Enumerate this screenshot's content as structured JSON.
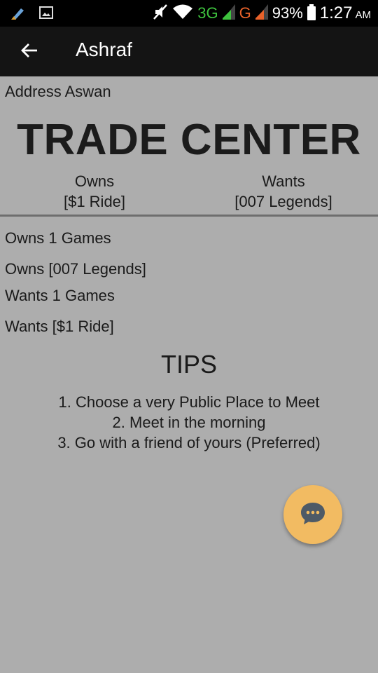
{
  "status_bar": {
    "network_1": "3G",
    "network_2": "G",
    "battery": "93%",
    "time": "1:27",
    "ampm": "AM",
    "colors": {
      "network_1": "#3ec23e",
      "network_2": "#e8622a"
    }
  },
  "app_bar": {
    "title": "Ashraf",
    "back_icon": "arrow-left-icon"
  },
  "address": "Address Aswan",
  "title": "TRADE CENTER",
  "owns": {
    "label": "Owns",
    "value": "[$1 Ride]"
  },
  "wants": {
    "label": "Wants",
    "value": "[007 Legends]"
  },
  "summary": [
    "Owns 1 Games",
    "Owns [007 Legends]",
    "Wants 1 Games",
    "Wants [$1 Ride]"
  ],
  "tips": {
    "title": "TIPS",
    "items": [
      "1. Choose a very Public Place to Meet",
      "2. Meet in the morning",
      "3. Go with a friend of yours (Preferred)"
    ]
  },
  "fab": {
    "icon": "chat-icon",
    "color": "#f2bb62"
  }
}
